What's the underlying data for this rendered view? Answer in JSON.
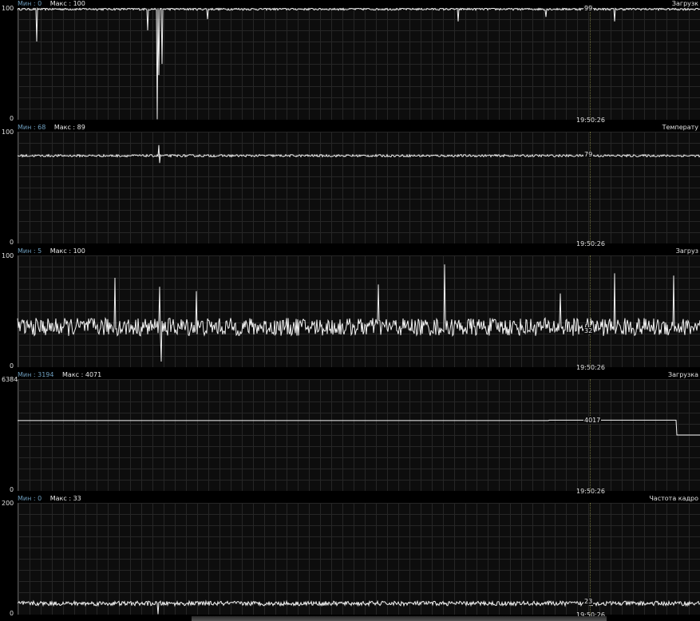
{
  "panels": [
    {
      "min_label": "Мин : 0",
      "max_label": "Макс : 100",
      "title": "Загрузк",
      "y_max": "100",
      "y_min": "0",
      "current_value": "99",
      "timestamp": "19:50:26",
      "scale_max": 100,
      "current": 99
    },
    {
      "min_label": "Мин : 68",
      "max_label": "Макс : 89",
      "title": "Температу",
      "y_max": "100",
      "y_min": "0",
      "current_value": "79",
      "timestamp": "19:50:26",
      "scale_max": 100,
      "current": 79
    },
    {
      "min_label": "Мин : 5",
      "max_label": "Макс : 100",
      "title": "Загруз",
      "y_max": "100",
      "y_min": "0",
      "current_value": "32",
      "timestamp": "19:50:26",
      "scale_max": 100,
      "current": 32
    },
    {
      "min_label": "Мин : 3194",
      "max_label": "Макс : 4071",
      "title": "Загрузка",
      "y_max": "6384",
      "y_min": "0",
      "current_value": "4017",
      "timestamp": "19:50:26",
      "scale_max": 6384,
      "current": 4017
    },
    {
      "min_label": "Мин : 0",
      "max_label": "Макс : 33",
      "title": "Частота кадро",
      "y_max": "200",
      "y_min": "0",
      "current_value": "23",
      "timestamp": "19:50:26",
      "scale_max": 200,
      "current": 23
    }
  ]
}
